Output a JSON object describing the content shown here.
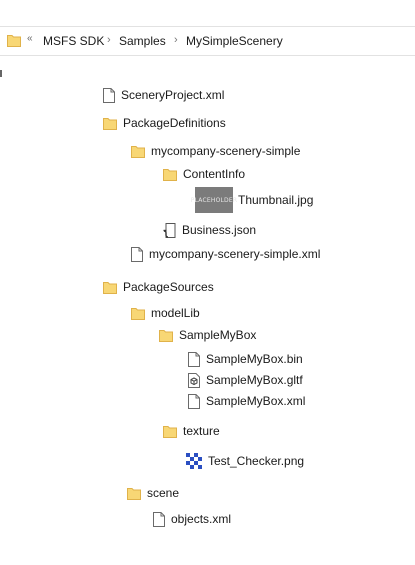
{
  "address_bar": {
    "overflow_glyph": "«",
    "crumbs": [
      "MSFS SDK",
      "Samples",
      "MySimpleScenery"
    ],
    "separator": "›"
  },
  "tree": [
    {
      "name": "SceneryProject.xml",
      "icon": "document-icon"
    },
    {
      "name": "PackageDefinitions",
      "icon": "folder-icon"
    },
    {
      "name": "mycompany-scenery-simple",
      "icon": "folder-icon"
    },
    {
      "name": "ContentInfo",
      "icon": "folder-icon"
    },
    {
      "name": "Thumbnail.jpg",
      "icon": "image-thumbnail",
      "thumbnail_text": "PLACEHOLDER"
    },
    {
      "name": "Business.json",
      "icon": "json-file-icon"
    },
    {
      "name": "mycompany-scenery-simple.xml",
      "icon": "document-icon"
    },
    {
      "name": "PackageSources",
      "icon": "folder-icon"
    },
    {
      "name": "modelLib",
      "icon": "folder-icon"
    },
    {
      "name": "SampleMyBox",
      "icon": "folder-icon"
    },
    {
      "name": "SampleMyBox.bin",
      "icon": "document-icon"
    },
    {
      "name": "SampleMyBox.gltf",
      "icon": "3d-model-icon"
    },
    {
      "name": "SampleMyBox.xml",
      "icon": "document-icon"
    },
    {
      "name": "texture",
      "icon": "folder-icon"
    },
    {
      "name": "Test_Checker.png",
      "icon": "checker-image-icon"
    },
    {
      "name": "scene",
      "icon": "folder-icon"
    },
    {
      "name": "objects.xml",
      "icon": "document-icon"
    }
  ],
  "colors": {
    "folder_fill": "#f8d775",
    "folder_edge": "#e0b24a",
    "checker_blue": "#2b4fc2"
  }
}
